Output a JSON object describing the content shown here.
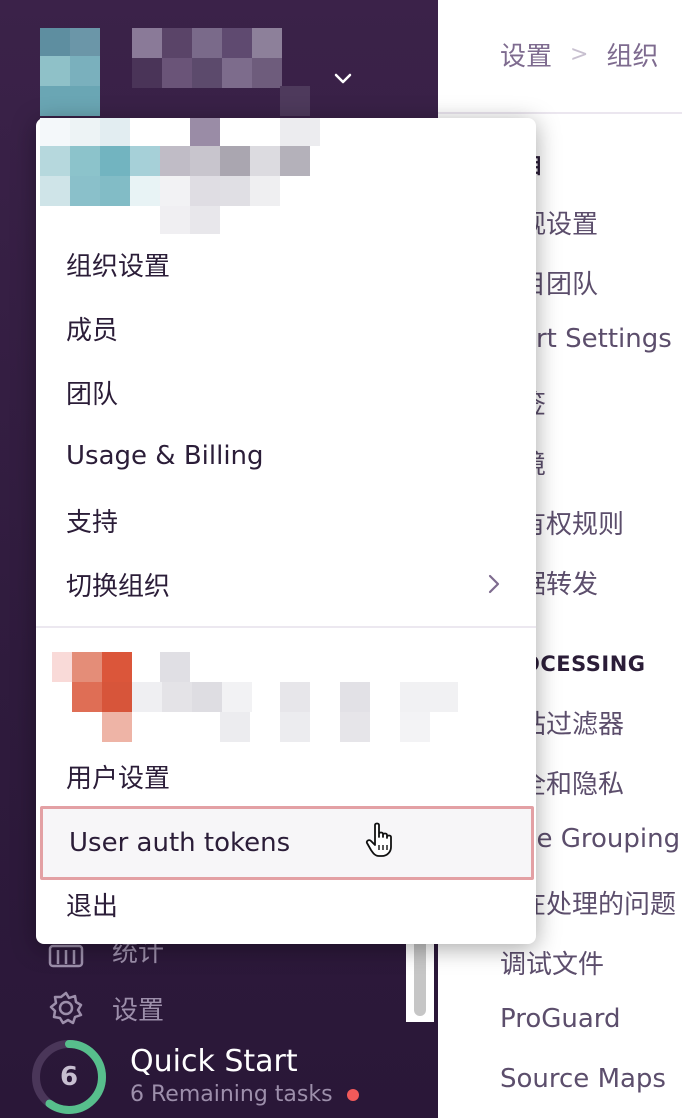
{
  "breadcrumb": {
    "items": [
      "设置",
      "组织"
    ]
  },
  "settings_nav": {
    "items": [
      "目",
      "观设置",
      "目团队",
      "ert Settings",
      "签",
      "境",
      "有权规则",
      "据转发",
      "OCESSING",
      "站过滤器",
      "全和隐私",
      "ue Grouping",
      "在处理的问题",
      "调试文件",
      "ProGuard",
      "Source Maps"
    ]
  },
  "dropdown": {
    "org_items": [
      {
        "label": "组织设置"
      },
      {
        "label": "成员"
      },
      {
        "label": "团队"
      },
      {
        "label": "Usage & Billing"
      },
      {
        "label": "支持"
      },
      {
        "label": "切换组织"
      }
    ],
    "user_items": [
      {
        "label": "用户设置"
      },
      {
        "label": "User auth tokens"
      },
      {
        "label": "退出"
      }
    ]
  },
  "sidebar": {
    "stats_label": "统计",
    "settings_label": "设置"
  },
  "quick_start": {
    "count": "6",
    "title": "Quick Start",
    "subtitle": "6 Remaining tasks",
    "progress_fraction": 0.6
  },
  "colors": {
    "sidebar_bg": "#2f1b3d",
    "accent_green": "#57be8c",
    "highlight_border": "#e3a0a4",
    "notice_dot": "#f15a5a"
  },
  "icons": [
    "chevron-down-icon",
    "chevron-right-icon",
    "stats-icon",
    "gear-icon",
    "hand-cursor-icon"
  ]
}
